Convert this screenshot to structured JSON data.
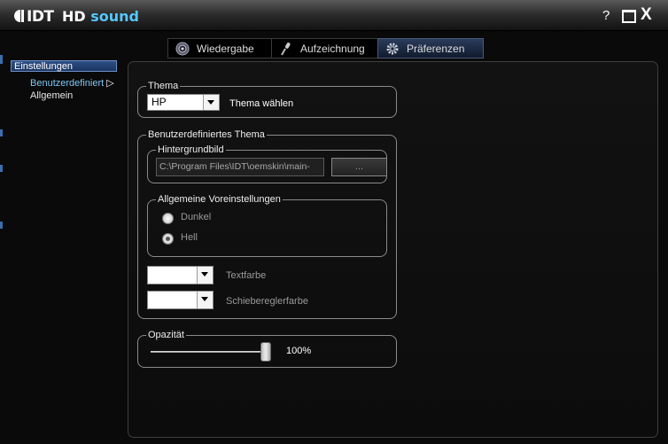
{
  "titlebar": {
    "logo": "IDT",
    "app_name_prefix": "HD",
    "app_name_suffix": "sound",
    "help": "?",
    "close": "X"
  },
  "tabs": [
    {
      "label": "Wiedergabe",
      "icon": "speaker-icon"
    },
    {
      "label": "Aufzeichnung",
      "icon": "microphone-icon"
    },
    {
      "label": "Präferenzen",
      "icon": "gear-icon",
      "active": true
    }
  ],
  "sidebar": {
    "selected": "Einstellungen",
    "items": [
      {
        "label": "Benutzerdefiniert",
        "arrow": "▷"
      },
      {
        "label": "Allgemein"
      }
    ]
  },
  "theme": {
    "legend": "Thema",
    "selected": "HP",
    "choose_label": "Thema wählen"
  },
  "custom_theme": {
    "legend": "Benutzerdefiniertes Thema",
    "background": {
      "legend": "Hintergrundbild",
      "path": "C:\\Program Files\\IDT\\oemskin\\main-",
      "browse": "..."
    },
    "presets": {
      "legend": "Allgemeine Voreinstellungen",
      "options": [
        {
          "label": "Dunkel",
          "checked": false
        },
        {
          "label": "Hell",
          "checked": true
        }
      ]
    },
    "text_color_label": "Textfarbe",
    "slider_color_label": "Schiebereglerfarbe"
  },
  "opacity": {
    "legend": "Opazität",
    "value": "100%",
    "level": 1.0
  },
  "colors": {
    "accent": "#55c8ff",
    "tab_active": "#2a3c5c",
    "selection": "#2c4f86"
  }
}
